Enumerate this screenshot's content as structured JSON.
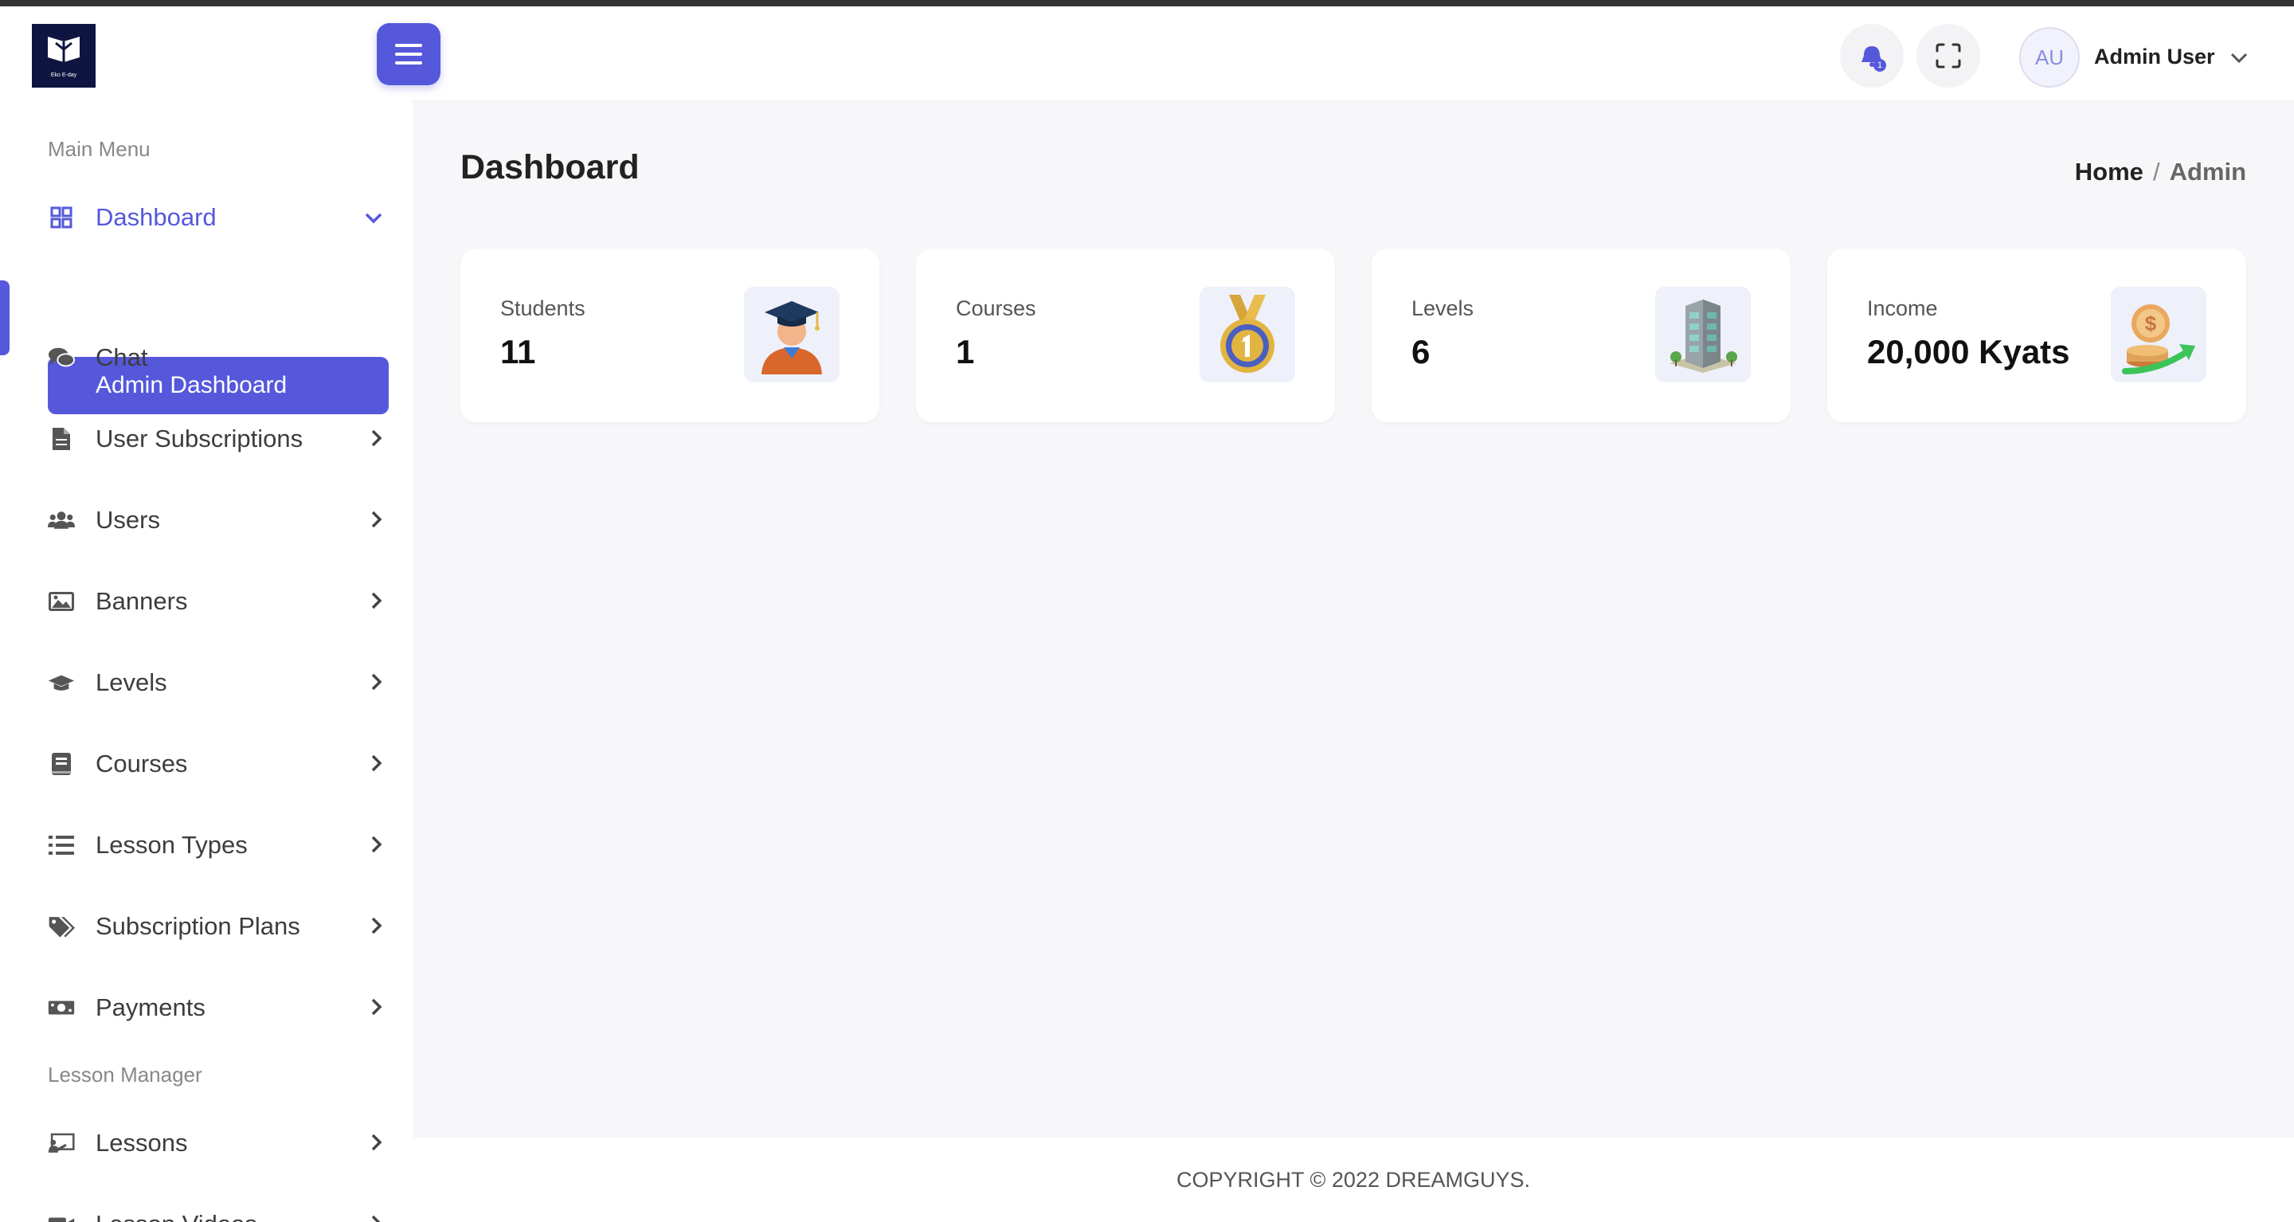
{
  "header": {
    "logo_text": "Eko E-day",
    "notification_count": "1",
    "user_initials": "AU",
    "user_name": "Admin User"
  },
  "sidebar": {
    "main_menu_title": "Main Menu",
    "lesson_manager_title": "Lesson Manager",
    "items": [
      {
        "label": "Dashboard",
        "icon": "grid-icon"
      },
      {
        "label": "Chat",
        "icon": "chat-icon"
      },
      {
        "label": "User Subscriptions",
        "icon": "file-icon"
      },
      {
        "label": "Users",
        "icon": "users-icon"
      },
      {
        "label": "Banners",
        "icon": "image-icon"
      },
      {
        "label": "Levels",
        "icon": "graduation-cap-icon"
      },
      {
        "label": "Courses",
        "icon": "book-icon"
      },
      {
        "label": "Lesson Types",
        "icon": "list-icon"
      },
      {
        "label": "Subscription Plans",
        "icon": "tags-icon"
      },
      {
        "label": "Payments",
        "icon": "money-icon"
      },
      {
        "label": "Lessons",
        "icon": "chalkboard-icon"
      },
      {
        "label": "Lesson Videos",
        "icon": "video-icon"
      }
    ],
    "sub_active": "Admin Dashboard"
  },
  "main": {
    "title": "Dashboard",
    "breadcrumb": {
      "home": "Home",
      "sep": "/",
      "current": "Admin"
    },
    "cards": [
      {
        "label": "Students",
        "value": "11",
        "icon": "graduate-icon"
      },
      {
        "label": "Courses",
        "value": "1",
        "icon": "medal-icon"
      },
      {
        "label": "Levels",
        "value": "6",
        "icon": "building-icon"
      },
      {
        "label": "Income",
        "value": "20,000 Kyats",
        "icon": "coin-growth-icon"
      }
    ]
  },
  "footer": {
    "text": "COPYRIGHT © 2022 DREAMGUYS."
  },
  "colors": {
    "accent": "#5558db",
    "background": "#f7f7fa"
  }
}
